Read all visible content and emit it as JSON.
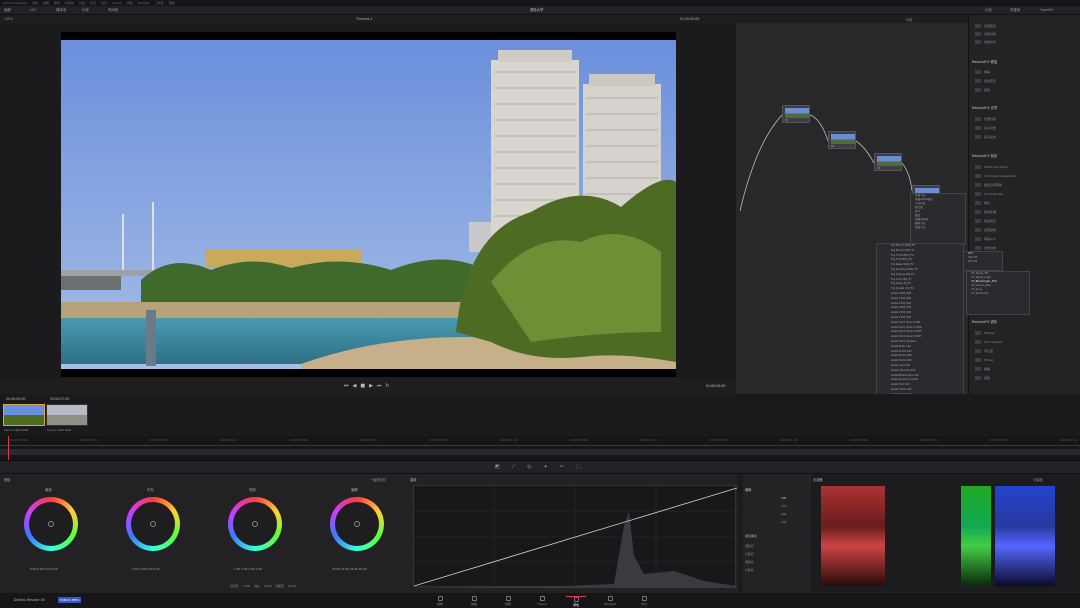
{
  "menubar": [
    "DaVinci Resolve",
    "文件",
    "编辑",
    "修剪",
    "时间线",
    "片段",
    "标记",
    "显示",
    "Fusion",
    "调色",
    "Fairlight",
    "工作区",
    "帮助"
  ],
  "toolbar": {
    "left": [
      "画廊",
      "LUT",
      "媒体池",
      "片段",
      "时间线"
    ],
    "center_title": "调色大学",
    "right": [
      "片段",
      "关键帧",
      "OpenFX"
    ]
  },
  "viewer": {
    "zoom": "100%",
    "timeline_name": "Timeline 1",
    "timecode_top": "01:00:00:00",
    "timecode": "01:00:00:00"
  },
  "node_editor": {
    "mode": "片段",
    "nodes": [
      "01",
      "02",
      "03",
      "04",
      "05"
    ]
  },
  "context_menu_node": [
    "添加节点",
    "添加Alpha输出",
    "节点标签",
    "校正器",
    "并行",
    "图层",
    "添加到片段",
    "删除节点",
    "重置节点"
  ],
  "context_menu_lut": [
    "LUT",
    "3D LUT",
    "1D LUT"
  ],
  "context_menu_lut_sub": [
    "VT_Alpha_3D",
    "VT_Alpha_LogC",
    "VT_Blackmagic_Film",
    "VT_Canon_Raw",
    "VT_Sony",
    "VT_Panasonic"
  ],
  "lut_list": [
    "Fuji Eterna 250D_FC",
    "Fuji Eterna 500T_FC",
    "Fuji F-125 8543_FC",
    "Fuji F-64 8510_FC",
    "Fuji Reala 500D_FC",
    "Fuji Sensitive 500T_FC",
    "Fuji Superia 800_FC",
    "Fuji Vivid 160_FC",
    "Fuji Velvia 50_FC",
    "Fuji Crystal 100_FC",
    "Kodak 2383_D55",
    "Kodak 2383_D60",
    "Kodak 2383_D65",
    "Kodak 2393_D55",
    "Kodak 2393_D60",
    "Kodak 2393_D65",
    "Kodak 5203 Vision3 50D",
    "Kodak 5207 Vision3 250D",
    "Kodak 5213 Vision3 200T",
    "Kodak 5219 Vision3 500T",
    "Kodak 5222 Double-X",
    "Kodak Ektar 100",
    "Kodak Portra 160",
    "Kodak Portra 400",
    "Kodak Portra 800",
    "Kodak Gold 200",
    "Kodak Ultramax 400",
    "Kodak Ektachrome 100",
    "Kodak Kodachrome 64",
    "Kodak Tri-X 400",
    "Kodak T-Max 100",
    "Kodak T-Max 400",
    "Kodak Vision 2383",
    "Kodak Vision 2393",
    "Kodak Vision3 5203",
    "Kodak Vision3 5207",
    "Kodak Vision3 5213",
    "Kodak Vision3 5219",
    "Kodak Vision3 7203",
    "Kodak Vision3 7207",
    "Kodak Vision3 7213",
    "Kodak Vision3 7219",
    "Kodak Vision3 7222",
    "Kodak Vision3 7266",
    "Kodak Vision3 5294",
    "Kodak Vision3 5285",
    "Kodak Vision3 5277",
    "Kodak Vision3 5274",
    "Kodak Vision3 5263",
    "Kodak Vision3 5260",
    "Kodak Vision3 5248",
    "Kodak Vision3 5246",
    "Kodak Vision3 5245",
    "Kodak Vision3 5239",
    "Kodak Vision3 5229",
    "Kodak Vision3 5218",
    "Kodak Vision3 5217",
    "Kodak Vision3 5212",
    "Kodak Vision3 5205",
    "Kodak Vision3 5201",
    "LOG Kodak 2383",
    "LOG Kodak 2393",
    "LOG Fuji 3513",
    "LOG Fuji 3510",
    "Leica Look 01",
    "Leica Look 02",
    "Leica Look 03",
    "Leica Look 04",
    "Leica Look 05",
    "Leica Look 06"
  ],
  "fx_panel": {
    "sections": [
      {
        "title": "ResolveFX 修复",
        "items": [
          "降噪",
          "色彩稳定",
          "颜色"
        ]
      },
      {
        "title": "ResolveFX 光学",
        "items": [
          "光圈衍射",
          "镜头光斑",
          "镜头反射"
        ]
      },
      {
        "title": "ResolveFX 色彩",
        "items": [
          "ACES Transform",
          "Chromatic Adaptation",
          "颜色空间转换",
          "Contrast Pop",
          "伽马",
          "色彩补偿",
          "色彩校正",
          "反转颜色",
          "转换LUT",
          "浅色合成"
        ]
      },
      {
        "title": "ResolveFX 锐化",
        "items": [
          "Warper",
          "Grid Warper",
          "对比度",
          "Flicker",
          "模糊",
          "画笔"
        ]
      }
    ],
    "top_items": [
      "深层修复",
      "去除闪烁",
      "去除水印"
    ]
  },
  "transport_timecode": "01:00:00:00",
  "clips": [
    {
      "tc": "00:00:05:00",
      "label": "Canon C200 RAW"
    },
    {
      "tc": "00:00:07:00",
      "label": "Canon C200 RAW"
    }
  ],
  "ruler_ticks": [
    "01:00:00:00",
    "01:00:00:04",
    "01:00:00:08",
    "01:00:00:12",
    "01:00:00:16",
    "01:00:00:20",
    "01:00:00:24",
    "01:00:01:04",
    "01:00:01:08",
    "01:00:01:12",
    "01:00:01:16",
    "01:00:01:20",
    "01:00:01:24",
    "01:00:02:04",
    "01:00:02:08",
    "01:00:02:12"
  ],
  "wheels": {
    "title": "色轮",
    "mode": "一级校色轮",
    "items": [
      {
        "label": "暗部",
        "vals": [
          "0.00",
          "0.00",
          "0.00",
          "0.00"
        ]
      },
      {
        "label": "中灰",
        "vals": [
          "0.00",
          "0.00",
          "0.00",
          "0.00"
        ]
      },
      {
        "label": "亮部",
        "vals": [
          "1.00",
          "1.00",
          "1.00",
          "1.00"
        ]
      },
      {
        "label": "偏移",
        "vals": [
          "25.00",
          "25.00",
          "25.00",
          "25.00"
        ]
      }
    ],
    "bottom": [
      "对比度",
      "1.000",
      "轴心",
      "0.435",
      "饱和度",
      "50.00",
      "色调",
      "50.00",
      "亮度混合",
      "100.00"
    ]
  },
  "curves": {
    "title": "曲线",
    "ctl_title": "编辑",
    "ctl_rows": [
      "100",
      "100",
      "100",
      "100"
    ],
    "soft_clip": "柔化裁切",
    "soft_rows": [
      "低裁切",
      "高裁切",
      "低柔化",
      "高柔化"
    ]
  },
  "scope": {
    "title": "示波器",
    "mode": "分量图"
  },
  "status": {
    "app": "DaVinci Resolve 16",
    "badge": "PUBLIC BETA"
  },
  "pages": [
    "媒体",
    "快编",
    "剪辑",
    "Fusion",
    "调色",
    "Fairlight",
    "交付"
  ]
}
